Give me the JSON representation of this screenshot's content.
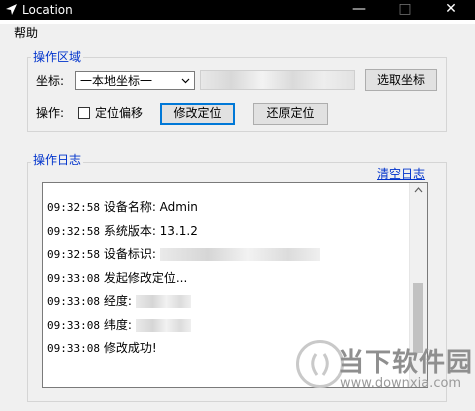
{
  "window": {
    "title": "Location",
    "minimize": "—",
    "maximize": "□",
    "close": "✕"
  },
  "menu": {
    "help": "帮助"
  },
  "ops_group": {
    "legend": "操作区域",
    "coord_label": "坐标:",
    "coord_value": "一本地坐标一",
    "select_button": "选取坐标",
    "ops_label": "操作:",
    "offset_checkbox_label": "定位偏移",
    "offset_checked": false,
    "modify_button": "修改定位",
    "restore_button": "还原定位"
  },
  "log_group": {
    "legend": "操作日志",
    "clear_link": "清空日志",
    "lines": [
      {
        "time": "09:32:58",
        "text": "设备名称: Admin"
      },
      {
        "time": "09:32:58",
        "text": "系统版本: 13.1.2"
      },
      {
        "time": "09:32:58",
        "text": "设备标识:"
      },
      {
        "time": "09:33:08",
        "text": "发起修改定位..."
      },
      {
        "time": "09:33:08",
        "text": "经度:"
      },
      {
        "time": "09:33:08",
        "text": "纬度:"
      },
      {
        "time": "09:33:08",
        "text": "修改成功!"
      }
    ]
  },
  "watermark": {
    "name": "当下软件园",
    "url": "www.downxia.com"
  },
  "colors": {
    "titlebar": "#000000",
    "client": "#f0f0f0",
    "legend": "#0033cc",
    "focus": "#0078d7"
  }
}
